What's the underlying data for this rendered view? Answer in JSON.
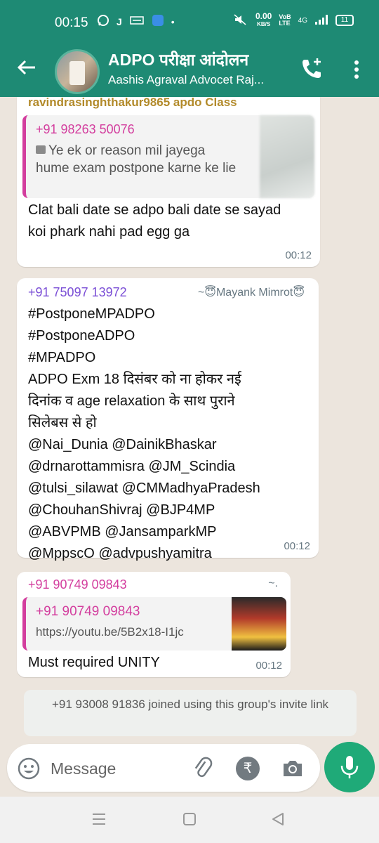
{
  "status_bar": {
    "time": "00:15",
    "data_speed": "0.00",
    "data_speed_unit": "KB/S",
    "network_type": "4G",
    "battery": "11"
  },
  "header": {
    "group_name": "ADPO  परीक्षा आंदोलन",
    "subtitle": "Aashis Agraval Advocet Raj..."
  },
  "messages": {
    "m1": {
      "sender": "ravindrasinghthakur9865 apdo Class",
      "quoted_sender": "+91 98263 50076",
      "quoted_text": "Ye ek or reason mil jayega hume exam postpone karne ke lie",
      "text": "Clat bali date se adpo bali date se sayad koi phark nahi pad egg ga",
      "time": "00:12"
    },
    "m2": {
      "sender_phone": "+91 75097 13972",
      "sender_name": "~😇Mayank Mimrot😇",
      "lines": [
        "#PostponeMPADPO",
        "#PostponeADPO",
        "#MPADPO",
        "ADPO Exm 18 दिसंबर को ना होकर नई",
        "दिनांक व age relaxation के साथ पुराने",
        "सिलेबस से हो",
        "@Nai_Dunia @DainikBhaskar",
        "@drnarottammisra @JM_Scindia",
        "@tulsi_silawat @CMMadhyaPradesh",
        "@ChouhanShivraj @BJP4MP",
        "@ABVPMB @JansamparkMP",
        "@MppscO @advpushyamitra"
      ],
      "time": "00:12"
    },
    "m3": {
      "sender_phone": "+91 90749 09843",
      "sender_name": "~.",
      "quoted_sender": "+91 90749 09843",
      "link": "https://youtu.be/5B2x18-I1jc",
      "text": "Must required UNITY",
      "time": "00:12"
    }
  },
  "system_message": "+91 93008 91836 joined using this group's invite link",
  "input": {
    "placeholder": "Message",
    "rupee_symbol": "₹"
  },
  "colors": {
    "app_bar": "#1e8a74",
    "mic_button": "#1faa78",
    "quote_accent": "#d33e9e",
    "sender_purple": "#7b4fd6"
  }
}
